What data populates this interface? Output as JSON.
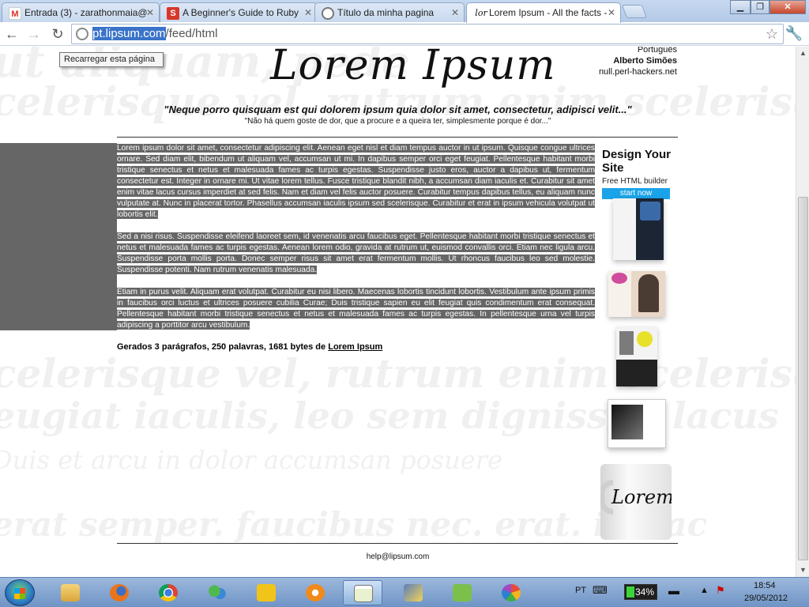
{
  "browser": {
    "tabs": [
      {
        "title": "Entrada (3) - zarathonmaia@",
        "favicon": "gmail-icon"
      },
      {
        "title": "A Beginner's Guide to Ruby",
        "favicon": "slideshare-icon"
      },
      {
        "title": "Título da minha pagina",
        "favicon": "globe-icon"
      },
      {
        "title": "Lorem Ipsum - All the facts -",
        "favicon": "lorem-ipsum-icon",
        "active": true
      }
    ],
    "url": {
      "host": "pt.lipsum.com",
      "path": "/feed/html"
    },
    "tooltip": "Recarregar esta página"
  },
  "page": {
    "logo": "Lorem Ipsum",
    "language": "Português",
    "author": "Alberto Simões",
    "author_site": "null.perl-hackers.net",
    "quote": "\"Neque porro quisquam est qui dolorem ipsum quia dolor sit amet, consectetur, adipisci velit...\"",
    "quote_translation": "\"Não há quem goste de dor, que a procure e a queira ter, simplesmente porque é dor...\"",
    "paragraphs": [
      "Lorem ipsum dolor sit amet, consectetur adipiscing elit. Aenean eget nisl et diam tempus auctor in ut ipsum. Quisque congue ultrices ornare. Sed diam elit, bibendum ut aliquam vel, accumsan ut mi. In dapibus semper orci eget feugiat. Pellentesque habitant morbi tristique senectus et netus et malesuada fames ac turpis egestas. Suspendisse justo eros, auctor a dapibus ut, fermentum consectetur est. Integer in ornare mi. Ut vitae lorem tellus. Fusce tristique blandit nibh, a accumsan diam iaculis et. Curabitur sit amet enim vitae lacus cursus imperdiet at sed felis. Nam et diam vel felis auctor posuere. Curabitur tempus dapibus tellus, eu aliquam nunc vulputate at. Nunc in placerat tortor. Phasellus accumsan iaculis ipsum sed scelerisque. Curabitur et erat in ipsum vehicula volutpat ut lobortis elit.",
      "Sed a nisi risus. Suspendisse eleifend laoreet sem, id venenatis arcu faucibus eget. Pellentesque habitant morbi tristique senectus et netus et malesuada fames ac turpis egestas. Aenean lorem odio, gravida at rutrum ut, euismod convallis orci. Etiam nec ligula arcu. Suspendisse porta mollis porta. Donec semper risus sit amet erat fermentum mollis. Ut rhoncus faucibus leo sed molestie. Suspendisse potenti. Nam rutrum venenatis malesuada.",
      "Etiam in purus velit. Aliquam erat volutpat. Curabitur eu nisi libero. Maecenas lobortis tincidunt lobortis. Vestibulum ante ipsum primis in faucibus orci luctus et ultrices posuere cubilia Curae; Duis tristique sapien eu elit feugiat quis condimentum erat consequat. Pellentesque habitant morbi tristique senectus et netus et malesuada fames ac turpis egestas. In pellentesque urna vel turpis adipiscing a porttitor arcu vestibulum."
    ],
    "generated_prefix": "Gerados 3 parágrafos, 250 palavras, 1681 bytes de",
    "generated_link": "Lorem Ipsum",
    "ad": {
      "title": "Design Your Site",
      "subtitle": "Free HTML builder",
      "button": "start now",
      "mug_text": "Lorem Ip"
    },
    "footer_email": "help@lipsum.com",
    "background_words": [
      "ut aliquam, pede",
      "celerisque vel, rutrum enim scelerisque",
      "eugiat iaculis, leo sem dignissim lacus",
      "Duis et arcu in dolor accumsan posuere",
      "erat semper. faucibus nec. erat. in hac"
    ]
  },
  "taskbar": {
    "apps": [
      "explorer-icon",
      "firefox-icon",
      "chrome-icon",
      "messenger-icon",
      "thunderbird-icon",
      "settings-gear-icon",
      "notepad-icon",
      "network-icon",
      "evernote-icon",
      "picasa-icon"
    ],
    "active_app": "notepad-icon",
    "language": "PT",
    "battery": "34%",
    "time": "18:54",
    "date": "29/05/2012"
  }
}
